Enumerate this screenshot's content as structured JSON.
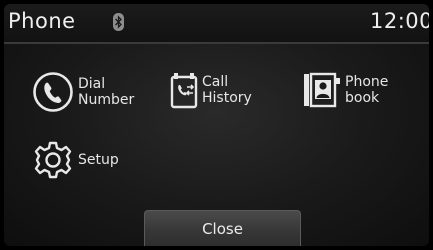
{
  "header": {
    "title": "Phone",
    "time": "12:00",
    "bluetooth_icon": "bluetooth-icon"
  },
  "menu": {
    "dial": {
      "label": "Dial\nNumber",
      "icon": "phone-handset-icon"
    },
    "call_history": {
      "label": "Call\nHistory",
      "icon": "call-history-icon"
    },
    "phone_book": {
      "label": "Phone\nbook",
      "icon": "contact-book-icon"
    },
    "setup": {
      "label": "Setup",
      "icon": "gear-icon"
    }
  },
  "footer": {
    "close_label": "Close"
  }
}
